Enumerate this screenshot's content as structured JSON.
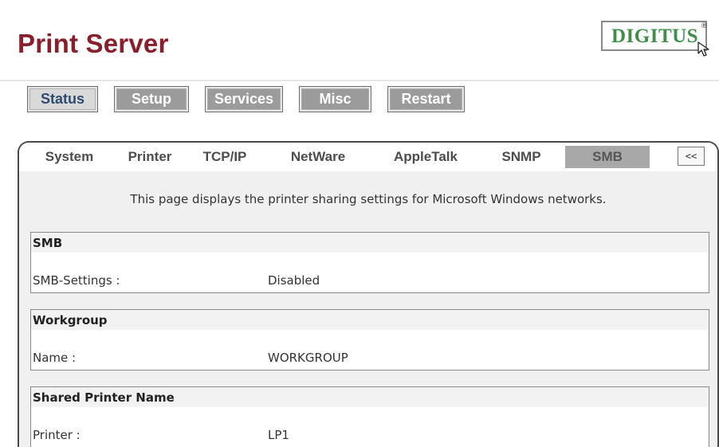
{
  "header": {
    "title": "Print Server",
    "logo_text": "DIGITUS",
    "logo_reg": "®"
  },
  "main_nav": [
    {
      "label": "Status",
      "active": true
    },
    {
      "label": "Setup",
      "active": false
    },
    {
      "label": "Services",
      "active": false
    },
    {
      "label": "Misc",
      "active": false
    },
    {
      "label": "Restart",
      "active": false
    }
  ],
  "sub_tabs": [
    {
      "label": "System",
      "active": false
    },
    {
      "label": "Printer",
      "active": false
    },
    {
      "label": "TCP/IP",
      "active": false
    },
    {
      "label": "NetWare",
      "active": false
    },
    {
      "label": "AppleTalk",
      "active": false
    },
    {
      "label": "SNMP",
      "active": false
    },
    {
      "label": "SMB",
      "active": true
    }
  ],
  "collapse_label": "<<",
  "description": "This page displays the printer sharing settings for Microsoft Windows networks.",
  "sections": [
    {
      "title": "SMB",
      "label": "SMB-Settings :",
      "value": "Disabled"
    },
    {
      "title": "Workgroup",
      "label": "Name :",
      "value": "WORKGROUP"
    },
    {
      "title": "Shared Printer Name",
      "label": "Printer :",
      "value": "LP1"
    }
  ],
  "colors": {
    "title": "#8b1e2b",
    "logo_text": "#3f8f4a",
    "active_tab_bg": "#a8a8a8",
    "button_bg": "#9b9b9b"
  }
}
